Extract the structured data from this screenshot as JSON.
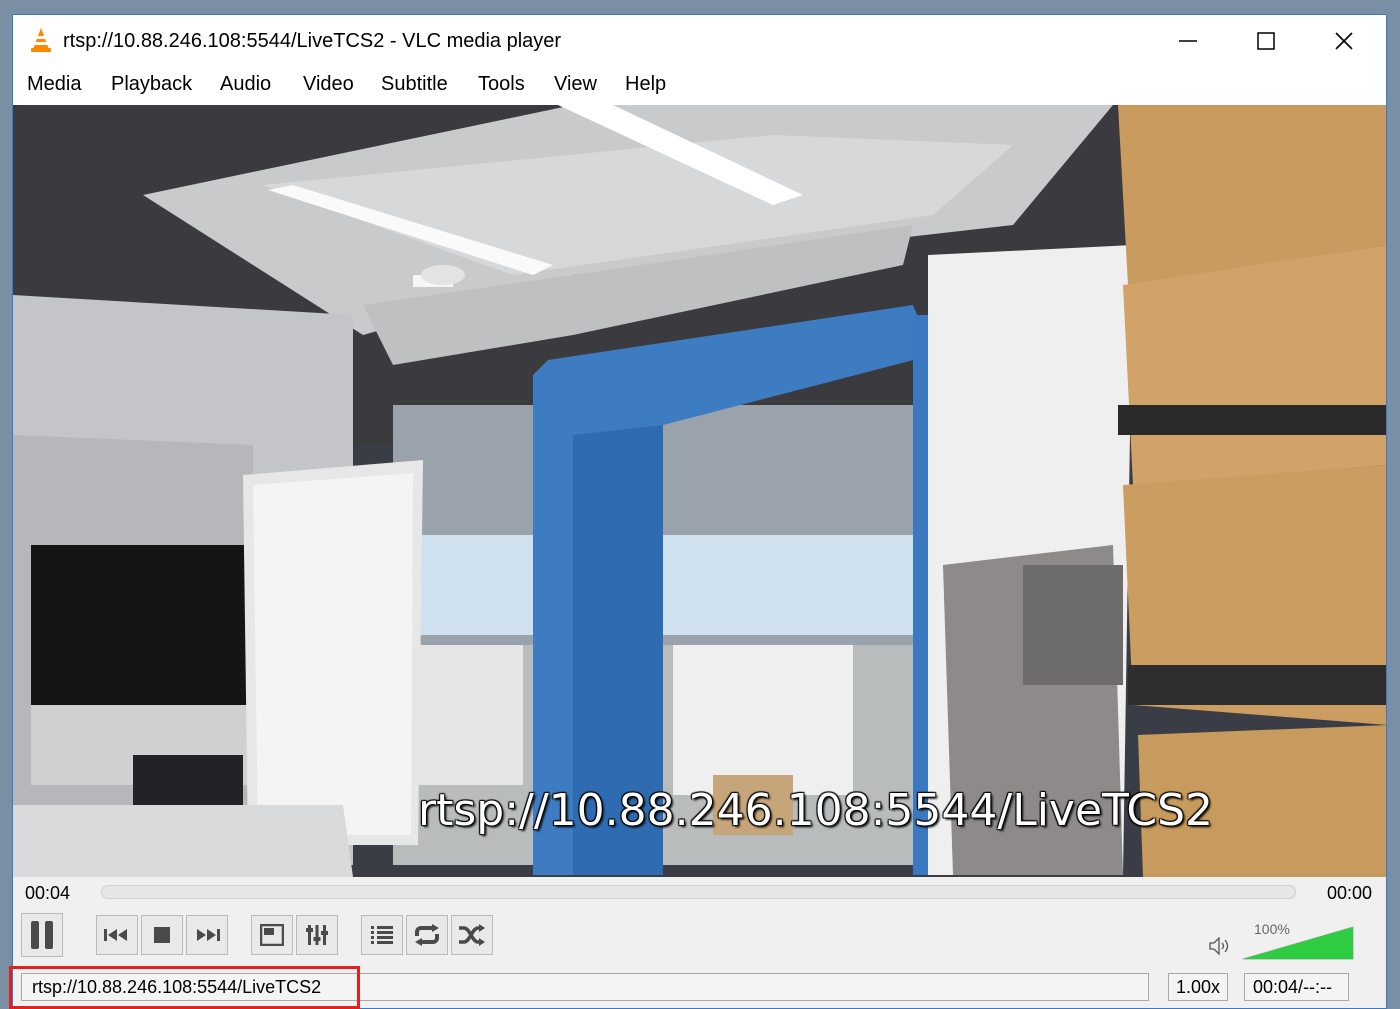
{
  "window": {
    "title": "rtsp://10.88.246.108:5544/LiveTCS2 - VLC media player",
    "icon": "vlc-cone-icon"
  },
  "titlebar_buttons": [
    "minimize-icon",
    "maximize-icon",
    "close-icon"
  ],
  "menu": [
    {
      "label": "Media"
    },
    {
      "label": "Playback"
    },
    {
      "label": "Audio"
    },
    {
      "label": "Video"
    },
    {
      "label": "Subtitle"
    },
    {
      "label": "Tools"
    },
    {
      "label": "View"
    },
    {
      "label": "Help"
    }
  ],
  "video": {
    "overlay_text": "rtsp://10.88.246.108:5544/LiveTCS2"
  },
  "seek": {
    "elapsed": "00:04",
    "total": "00:00",
    "progress": 0
  },
  "controls": {
    "icons": [
      "pause-icon",
      "previous-icon",
      "stop-icon",
      "next-icon",
      "fullscreen-icon",
      "extended-settings-icon",
      "playlist-icon",
      "loop-icon",
      "shuffle-icon"
    ],
    "volume_icon": "speaker-icon",
    "volume_level": "100%",
    "volume_fraction": 1.0
  },
  "status": {
    "url": "rtsp://10.88.246.108:5544/LiveTCS2",
    "rate": "1.00x",
    "time": "00:04/--:--"
  },
  "colors": {
    "window_border": "#3c78c8",
    "highlight": "#e0211f",
    "volume_fill": "#2ecc40",
    "vlc_orange": "#ff8800"
  }
}
